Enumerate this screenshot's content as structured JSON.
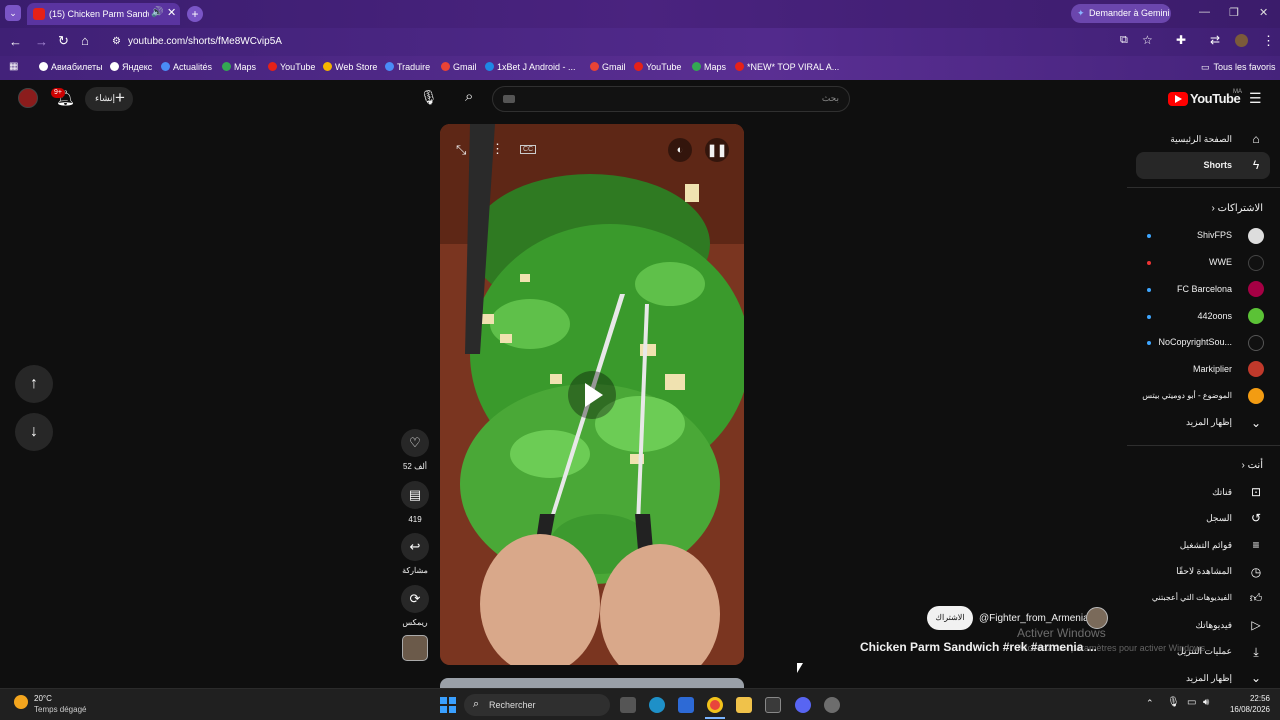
{
  "browser": {
    "tab_title": "(15) Chicken Parm Sandwich",
    "tab_close": "✕",
    "new_tab": "+",
    "gemini_button": "Demander à Gemini",
    "url": "youtube.com/shorts/fMe8WCvip5A",
    "bookmarks": [
      "Авиабилеты",
      "Яндекс",
      "Actualités",
      "Maps",
      "YouTube",
      "Web Store",
      "Traduire",
      "Gmail",
      "1xBet J Android - ...",
      "Gmail",
      "YouTube",
      "Maps",
      "*NEW* TOP VIRAL A..."
    ],
    "all_bookmarks": "Tous les favoris",
    "colors": {
      "chrome_purple": "#4a237f",
      "yt_red": "#ff0000"
    }
  },
  "youtube": {
    "logo_text": "YouTube",
    "logo_region": "MA",
    "create_label": "إنشاء",
    "notif_count": "9+",
    "search_placeholder": "بحث",
    "actions": {
      "likes": "52 ألف",
      "comments": "419",
      "share": "مشاركة",
      "remix": "ريمكس"
    },
    "channel_handle": "@Fighter_from_Armenia",
    "subscribe": "الاشتراك",
    "video_title": "Chicken Parm Sandwich #rek #armenia ...",
    "sidebar": {
      "home": "الصفحة الرئيسية",
      "shorts": "Shorts",
      "subscriptions": "الاشتراكات",
      "channels": [
        "ShivFPS",
        "WWE",
        "FC Barcelona",
        "442oons",
        "NoCopyrightSou...",
        "Markiplier",
        "الموضوع - أبو دوميتي بيتس"
      ],
      "show_more": "إظهار المزيد",
      "you": "أنت",
      "you_items": [
        "قناتك",
        "السجل",
        "قوائم التشغيل",
        "المشاهدة لاحقًا",
        "الفيديوهات التي أعجبتني",
        "فيديوهاتك",
        "عمليات التنزيل",
        "إظهار المزيد"
      ]
    }
  },
  "windows": {
    "activate_title": "Activer Windows",
    "activate_sub": "Accédez aux paramètres pour activer Windows.",
    "temperature": "20°C",
    "weather": "Temps dégagé",
    "search": "Rechercher",
    "time": "22:56",
    "date": "16/08/2026"
  }
}
